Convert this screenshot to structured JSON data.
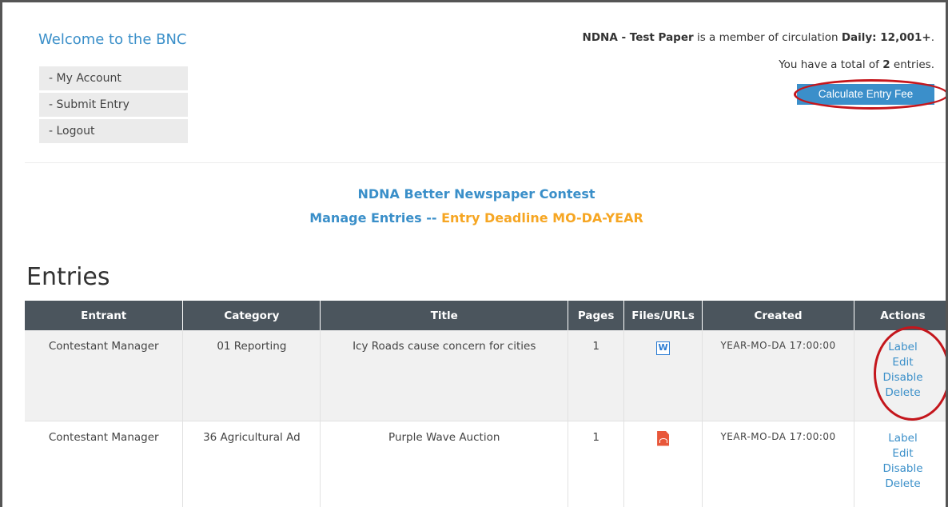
{
  "header": {
    "welcome": "Welcome to the BNC",
    "paper_name": "NDNA - Test Paper",
    "member_text": " is a member of circulation ",
    "circulation": "Daily: 12,001+",
    "member_end": ".",
    "entries_prefix": "You have a total of ",
    "entries_count": "2",
    "entries_suffix": " entries.",
    "fee_button": "Calculate Entry Fee"
  },
  "nav": {
    "items": [
      {
        "label": "- My Account"
      },
      {
        "label": "- Submit Entry"
      },
      {
        "label": "- Logout"
      }
    ]
  },
  "contest": {
    "title": "NDNA Better Newspaper Contest",
    "manage": "Manage Entries -- ",
    "deadline_label": "Entry Deadline ",
    "deadline_value": "MO-DA-YEAR"
  },
  "entries": {
    "heading": "Entries",
    "columns": [
      "Entrant",
      "Category",
      "Title",
      "Pages",
      "Files/URLs",
      "Created",
      "Actions"
    ],
    "rows": [
      {
        "entrant": "Contestant Manager",
        "category": "01 Reporting",
        "title": "Icy Roads cause concern for cities",
        "pages": "1",
        "file_icon": "word-icon",
        "file_glyph": "W",
        "created": "YEAR-MO-DA 17:00:00",
        "actions": [
          "Label",
          "Edit",
          "Disable",
          "Delete"
        ]
      },
      {
        "entrant": "Contestant Manager",
        "category": "36 Agricultural Ad",
        "title": "Purple Wave Auction",
        "pages": "1",
        "file_icon": "pdf-icon",
        "created": "YEAR-MO-DA 17:00:00",
        "actions": [
          "Label",
          "Edit",
          "Disable",
          "Delete"
        ]
      }
    ]
  },
  "colors": {
    "link_blue": "#3a8fc9",
    "deadline_orange": "#f6a623",
    "header_gray": "#4b555d",
    "highlight_red": "#c4161c"
  }
}
